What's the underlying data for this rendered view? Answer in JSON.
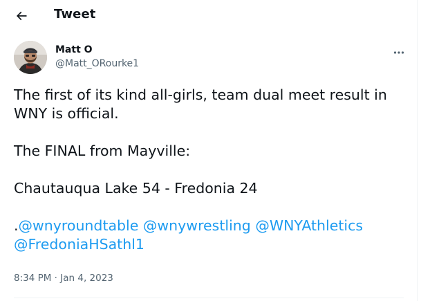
{
  "header": {
    "back_icon": "arrow-left-icon",
    "title": "Tweet"
  },
  "author": {
    "name": "Matt O",
    "handle": "@Matt_ORourke1",
    "avatar_icon": "profile-photo"
  },
  "more_icon": "more-dots-icon",
  "tweet": {
    "line1": "The first of its kind all-girls, team dual meet result in",
    "line2": "WNY is official.",
    "line3": "The FINAL from Mayville:",
    "line4": "Chautauqua Lake 54 - Fredonia 24",
    "line5_prefix": ".",
    "mentions": [
      "@wnyroundtable",
      "@wnywrestling",
      "@WNYAthletics",
      "@FredoniaHSathl1"
    ]
  },
  "timestamp": "8:34 PM · Jan 4, 2023",
  "colors": {
    "text": "#0f1419",
    "secondary": "#536471",
    "link": "#1d9bf0",
    "divider": "#eff3f4"
  }
}
